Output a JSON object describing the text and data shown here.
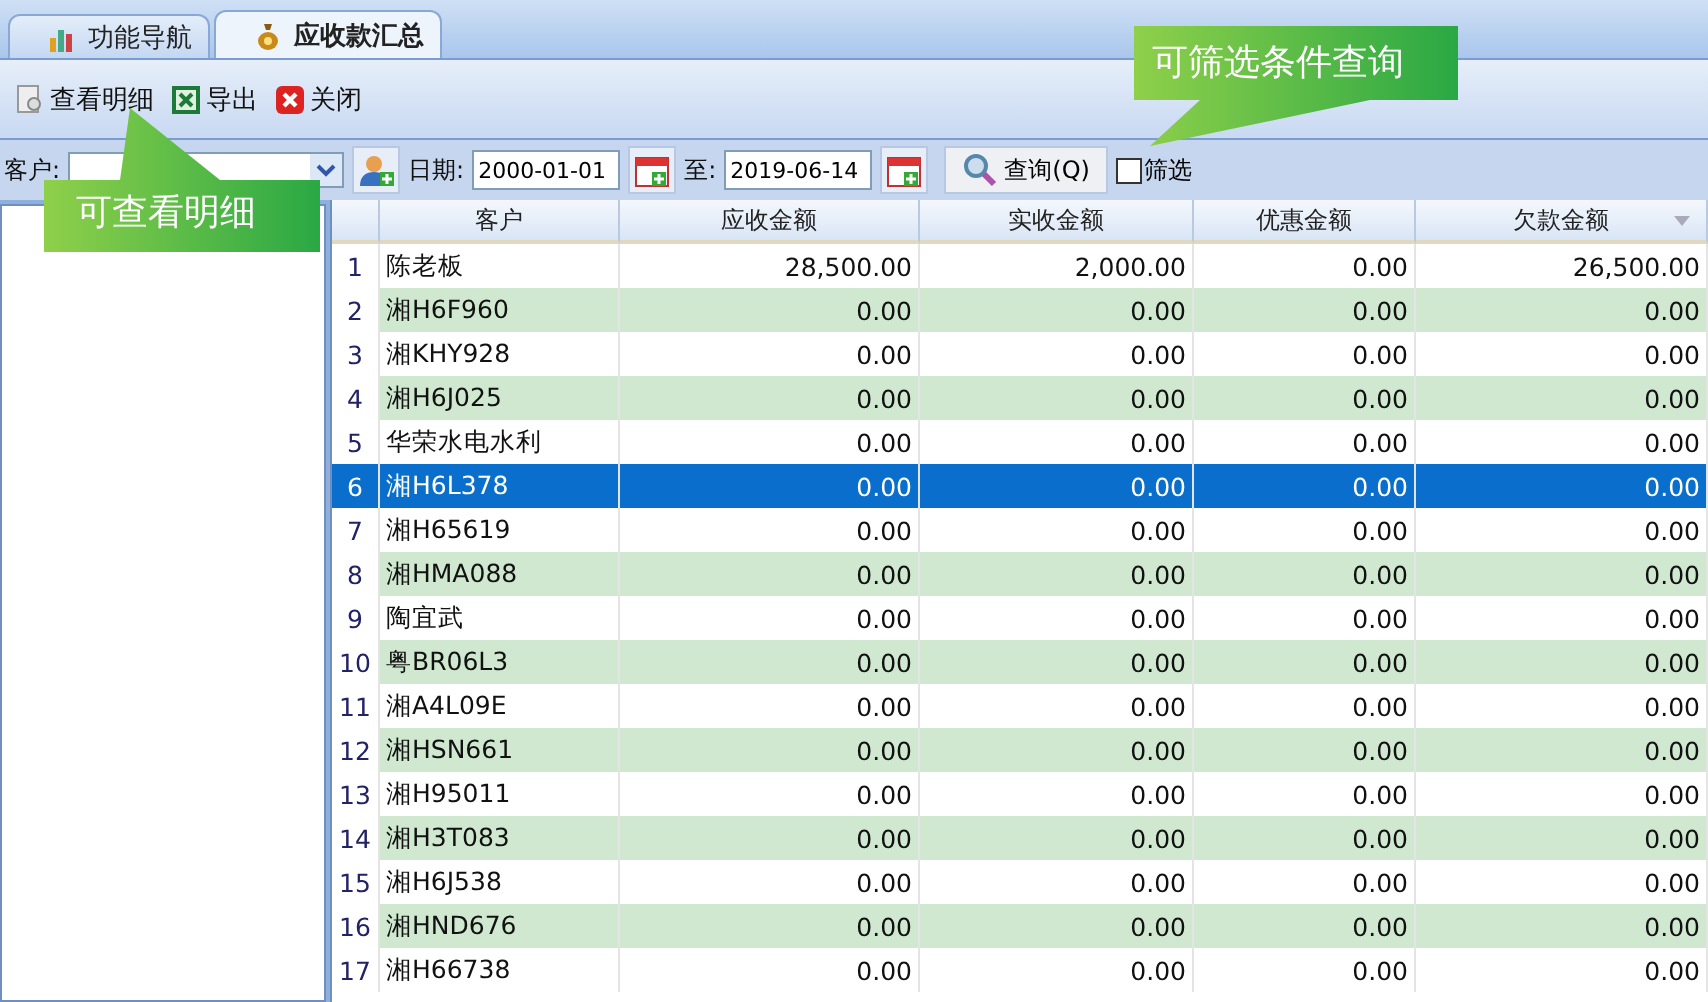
{
  "tabs": [
    {
      "label": "功能导航",
      "selected": false
    },
    {
      "label": "应收款汇总",
      "selected": true
    }
  ],
  "toolbar": [
    "查看明细",
    "导出",
    "关闭"
  ],
  "filter": {
    "customer_label": "客户:",
    "date_label": "日期:",
    "date_from": "2000-01-01",
    "to_label": "至:",
    "date_to": "2019-06-14",
    "query_button": "查询(Q)",
    "filter_checkbox": {
      "label": "筛选",
      "checked": false
    }
  },
  "table": {
    "columns": [
      "客户",
      "应收金额",
      "实收金额",
      "优惠金额",
      "欠款金额"
    ],
    "rows": [
      {
        "no": "1",
        "cells": [
          "陈老板",
          "28,500.00",
          "2,000.00",
          "0.00",
          "26,500.00"
        ],
        "selected": false
      },
      {
        "no": "2",
        "cells": [
          "湘H6F960",
          "0.00",
          "0.00",
          "0.00",
          "0.00"
        ],
        "selected": false
      },
      {
        "no": "3",
        "cells": [
          "湘KHY928",
          "0.00",
          "0.00",
          "0.00",
          "0.00"
        ],
        "selected": false
      },
      {
        "no": "4",
        "cells": [
          "湘H6J025",
          "0.00",
          "0.00",
          "0.00",
          "0.00"
        ],
        "selected": false
      },
      {
        "no": "5",
        "cells": [
          "华荣水电水利",
          "0.00",
          "0.00",
          "0.00",
          "0.00"
        ],
        "selected": false
      },
      {
        "no": "6",
        "cells": [
          "湘H6L378",
          "0.00",
          "0.00",
          "0.00",
          "0.00"
        ],
        "selected": true
      },
      {
        "no": "7",
        "cells": [
          "湘H65619",
          "0.00",
          "0.00",
          "0.00",
          "0.00"
        ],
        "selected": false
      },
      {
        "no": "8",
        "cells": [
          "湘HMA088",
          "0.00",
          "0.00",
          "0.00",
          "0.00"
        ],
        "selected": false
      },
      {
        "no": "9",
        "cells": [
          "陶宜武",
          "0.00",
          "0.00",
          "0.00",
          "0.00"
        ],
        "selected": false
      },
      {
        "no": "10",
        "cells": [
          "粤BR06L3",
          "0.00",
          "0.00",
          "0.00",
          "0.00"
        ],
        "selected": false
      },
      {
        "no": "11",
        "cells": [
          "湘A4L09E",
          "0.00",
          "0.00",
          "0.00",
          "0.00"
        ],
        "selected": false
      },
      {
        "no": "12",
        "cells": [
          "湘HSN661",
          "0.00",
          "0.00",
          "0.00",
          "0.00"
        ],
        "selected": false
      },
      {
        "no": "13",
        "cells": [
          "湘H95011",
          "0.00",
          "0.00",
          "0.00",
          "0.00"
        ],
        "selected": false
      },
      {
        "no": "14",
        "cells": [
          "湘H3T083",
          "0.00",
          "0.00",
          "0.00",
          "0.00"
        ],
        "selected": false
      },
      {
        "no": "15",
        "cells": [
          "湘H6J538",
          "0.00",
          "0.00",
          "0.00",
          "0.00"
        ],
        "selected": false
      },
      {
        "no": "16",
        "cells": [
          "湘HND676",
          "0.00",
          "0.00",
          "0.00",
          "0.00"
        ],
        "selected": false
      },
      {
        "no": "17",
        "cells": [
          "湘H66738",
          "0.00",
          "0.00",
          "0.00",
          "0.00"
        ],
        "selected": false
      }
    ]
  },
  "callouts": [
    {
      "text": "可查看明细",
      "kind": "up"
    },
    {
      "text": "可筛选条件查询",
      "kind": "down"
    }
  ]
}
